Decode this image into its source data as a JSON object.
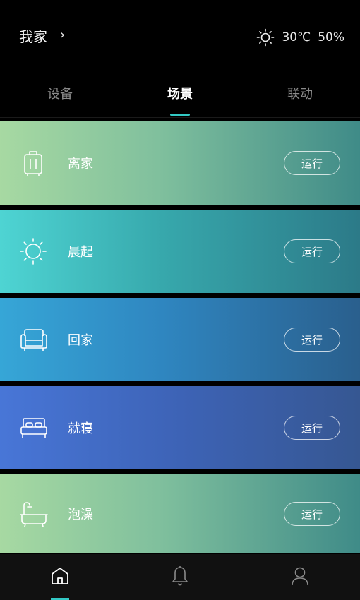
{
  "header": {
    "home_name": "我家",
    "chevron": "›",
    "weather": {
      "icon": "sun-icon",
      "temperature": "30℃",
      "humidity": "50%"
    }
  },
  "tabs": [
    {
      "label": "设备",
      "active": false
    },
    {
      "label": "场景",
      "active": true
    },
    {
      "label": "联动",
      "active": false
    }
  ],
  "scenes": [
    {
      "label": "离家",
      "icon": "luggage-icon",
      "button": "运行"
    },
    {
      "label": "晨起",
      "icon": "sun-icon",
      "button": "运行"
    },
    {
      "label": "回家",
      "icon": "sofa-icon",
      "button": "运行"
    },
    {
      "label": "就寝",
      "icon": "bed-icon",
      "button": "运行"
    },
    {
      "label": "泡澡",
      "icon": "bathtub-icon",
      "button": "运行"
    }
  ],
  "bottom_nav": [
    {
      "icon": "home-icon",
      "active": true
    },
    {
      "icon": "bell-icon",
      "active": false
    },
    {
      "icon": "user-icon",
      "active": false
    }
  ],
  "colors": {
    "accent": "#33c9c5",
    "background": "#000000"
  }
}
